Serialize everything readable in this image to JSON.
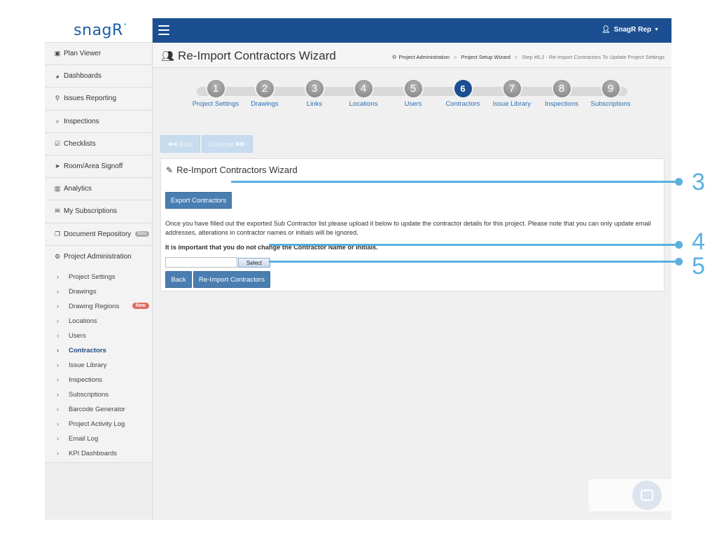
{
  "brand": {
    "logo": "snagR"
  },
  "topbar": {
    "user": "SnagR Rep"
  },
  "sidebar": {
    "items": [
      {
        "label": "Plan Viewer",
        "icon": "image-icon"
      },
      {
        "label": "Dashboards",
        "icon": "dashboard-icon"
      },
      {
        "label": "Issues Reporting",
        "icon": "map-marker-icon"
      },
      {
        "label": "Inspections",
        "icon": "search-icon"
      },
      {
        "label": "Checklists",
        "icon": "checkbox-icon"
      },
      {
        "label": "Room/Area Signoff",
        "icon": "location-arrow-icon"
      },
      {
        "label": "Analytics",
        "icon": "bar-chart-icon"
      },
      {
        "label": "My Subscriptions",
        "icon": "envelope-icon"
      },
      {
        "label": "Document Repository",
        "icon": "copy-icon",
        "badge": "Beta"
      },
      {
        "label": "Project Administration",
        "icon": "gears-icon"
      }
    ],
    "sub_items": [
      {
        "label": "Project Settings"
      },
      {
        "label": "Drawings"
      },
      {
        "label": "Drawing Regions",
        "badge": "New"
      },
      {
        "label": "Locations"
      },
      {
        "label": "Users"
      },
      {
        "label": "Contractors",
        "active": true
      },
      {
        "label": "Issue Library"
      },
      {
        "label": "Inspections"
      },
      {
        "label": "Subscriptions"
      },
      {
        "label": "Barcode Generator"
      },
      {
        "label": "Project Activity Log"
      },
      {
        "label": "Email Log"
      },
      {
        "label": "KPI Dashboards"
      }
    ]
  },
  "header": {
    "title": "Re-Import Contractors Wizard",
    "breadcrumb": [
      "Project Administration",
      "Project Setup Wizard",
      "Step #6.2 - Re-Import Contractors To Update Project Settings"
    ]
  },
  "wizard": {
    "active_step": 6,
    "steps": [
      {
        "num": "1",
        "label": "Project Settings"
      },
      {
        "num": "2",
        "label": "Drawings"
      },
      {
        "num": "3",
        "label": "Links"
      },
      {
        "num": "4",
        "label": "Locations"
      },
      {
        "num": "5",
        "label": "Users"
      },
      {
        "num": "6",
        "label": "Contractors"
      },
      {
        "num": "7",
        "label": "Issue Library"
      },
      {
        "num": "8",
        "label": "Inspections"
      },
      {
        "num": "9",
        "label": "Subscriptions"
      }
    ]
  },
  "actionbar": {
    "back": "Back",
    "continue": "Continue"
  },
  "panel": {
    "title": "Re-Import Contractors Wizard",
    "export_label": "Export Contractors",
    "description": "Once you have filled out the exported Sub Contractor list please upload it below to update the contractor details for this project. Please note that you can only update email addresses, alterations in contractor names or initials will be ignored.",
    "warning": "It is important that you do not change the Contractor Name or Initials.",
    "file_value": "",
    "select_label": "Select",
    "back_label": "Back",
    "reimport_label": "Re-Import Contractors"
  },
  "callouts": [
    "3",
    "4",
    "5"
  ],
  "colors": {
    "brand_blue": "#1b4f91",
    "button_blue": "#4a7eb1",
    "callout": "#5bb0e0",
    "link": "#2a6fb5",
    "new_badge": "#e06a5d"
  }
}
